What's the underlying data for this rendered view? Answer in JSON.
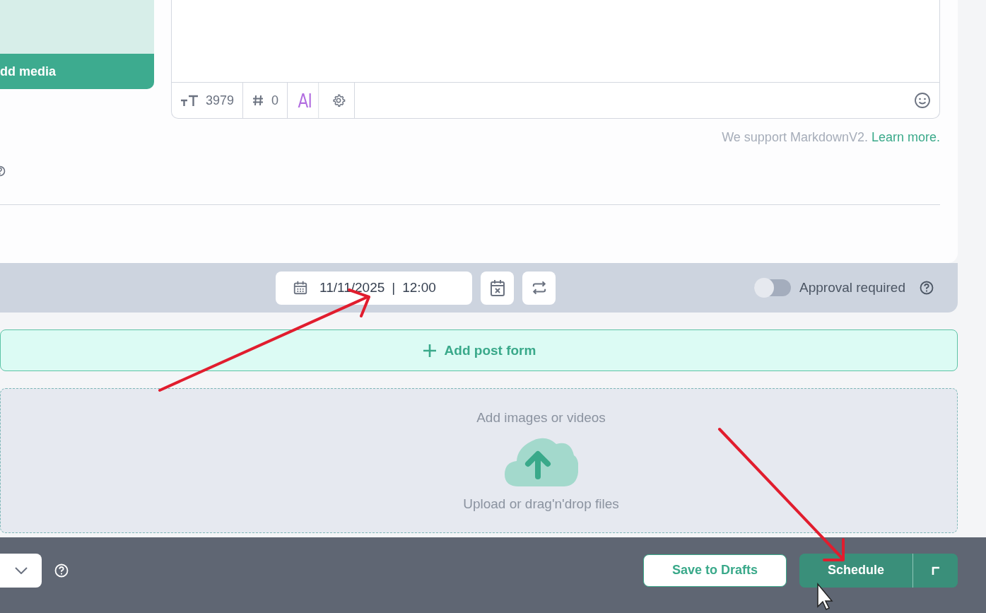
{
  "media_panel": {
    "button": "dd media"
  },
  "editor": {
    "char_count": "3979",
    "hashtag_count": "0",
    "ai_label": "AI",
    "note": "We support MarkdownV2.",
    "note_link": "Learn more."
  },
  "schedule_bar": {
    "date": "11/11/2025",
    "separator": "|",
    "time": "12:00",
    "approval": {
      "label": "Approval required",
      "on": false
    }
  },
  "add_post_form": {
    "label": "Add post form"
  },
  "dropzone": {
    "title": "Add images or videos",
    "hint": "Upload or drag'n'drop files"
  },
  "footer": {
    "save_button": "Save to Drafts",
    "schedule_button": "Schedule"
  }
}
